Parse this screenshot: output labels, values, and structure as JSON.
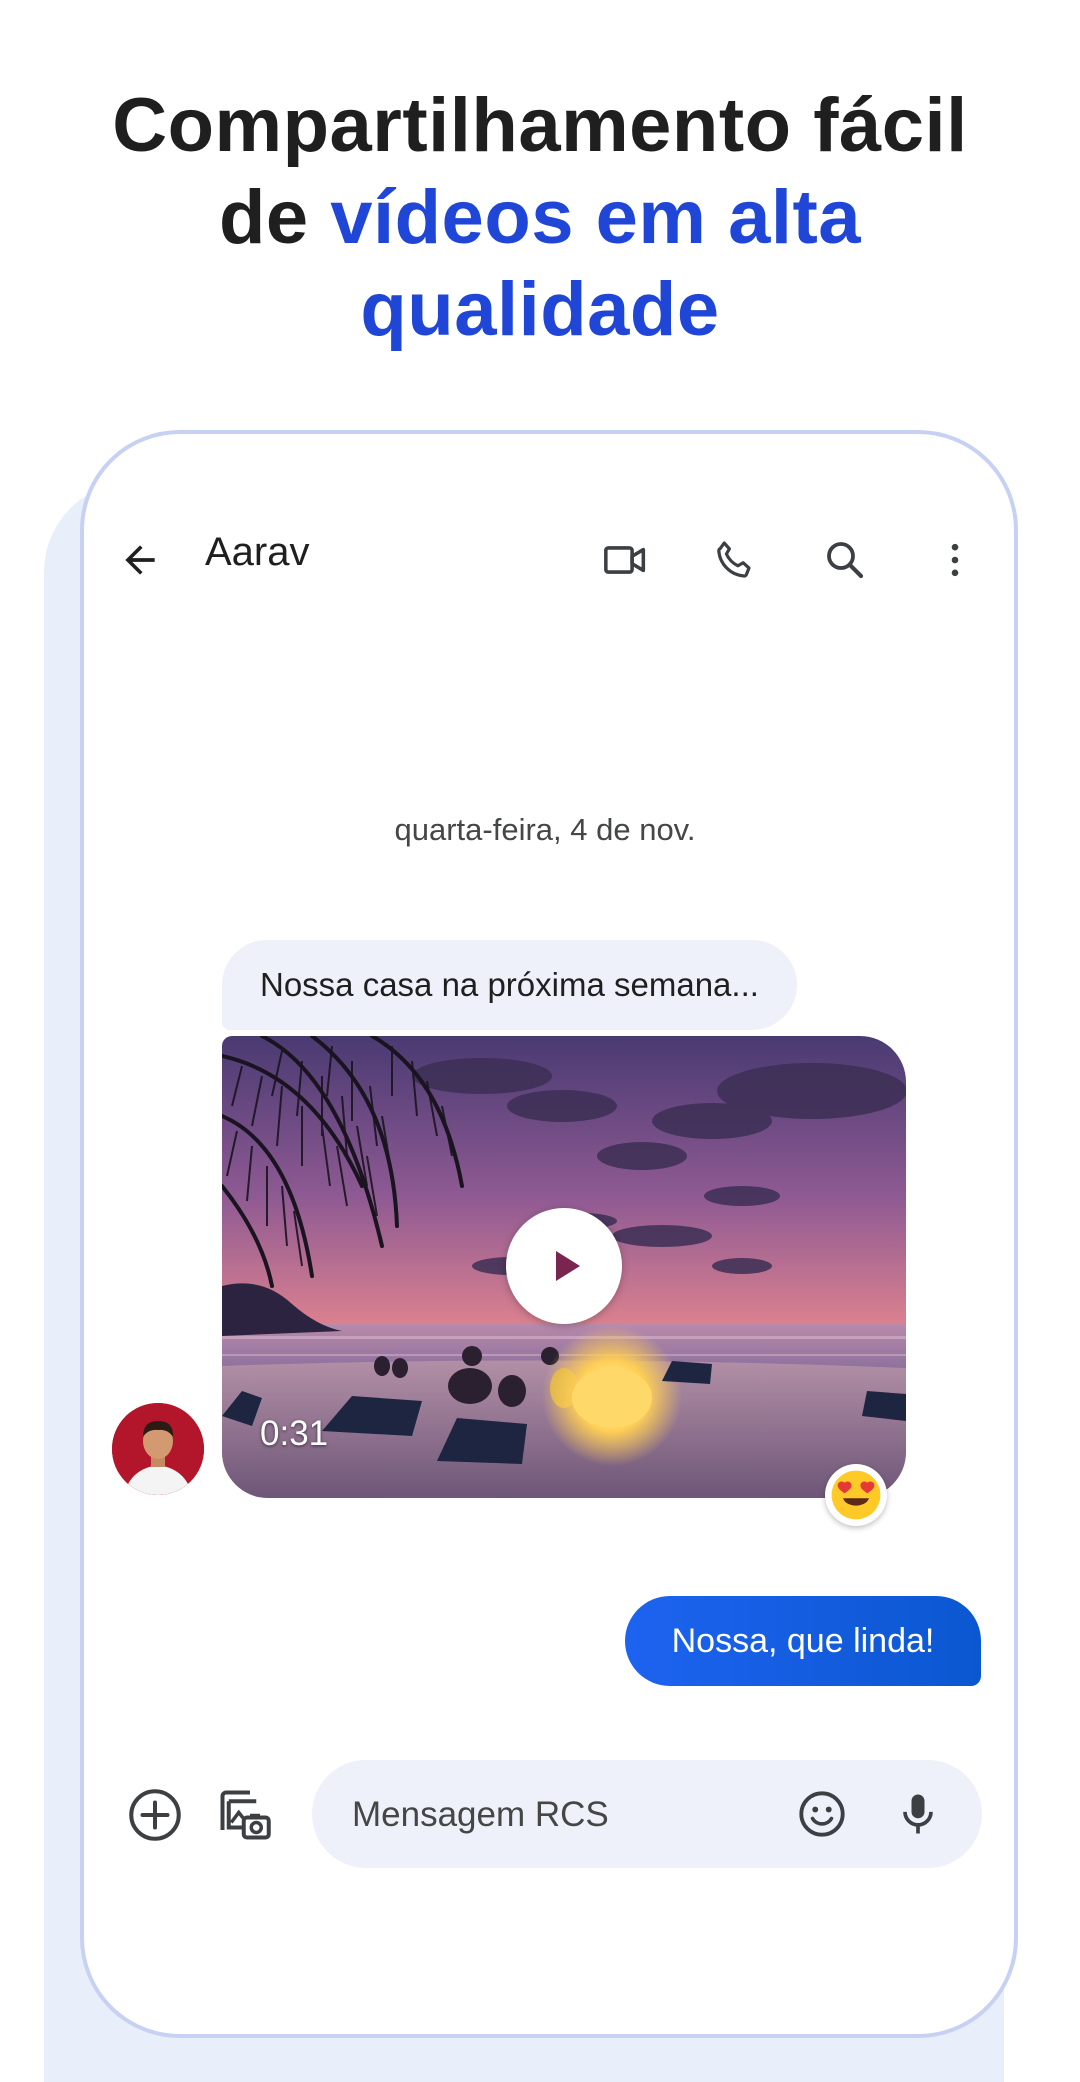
{
  "headline": {
    "line1": "Compartilhamento fácil",
    "line2_prefix": "de ",
    "line2_highlight": "vídeos em alta",
    "line3_highlight": "qualidade"
  },
  "appbar": {
    "contact_name": "Aarav",
    "icons": [
      "back-arrow-icon",
      "video-call-icon",
      "phone-icon",
      "search-icon",
      "more-vert-icon"
    ]
  },
  "conversation": {
    "date_separator": "quarta-feira, 4 de nov.",
    "incoming_message": "Nossa casa na próxima semana...",
    "video": {
      "duration": "0:31",
      "reaction": "heart-eyes-emoji"
    },
    "outgoing_message": "Nossa, que linda!"
  },
  "composer": {
    "placeholder": "Mensagem RCS",
    "icons": [
      "add-icon",
      "gallery-camera-icon",
      "emoji-icon",
      "mic-icon"
    ]
  },
  "colors": {
    "accent_blue": "#1f46d6",
    "sent_bubble": "#0b57d0",
    "received_bubble": "#eef1fa",
    "frame_border": "#c7d1f3"
  }
}
